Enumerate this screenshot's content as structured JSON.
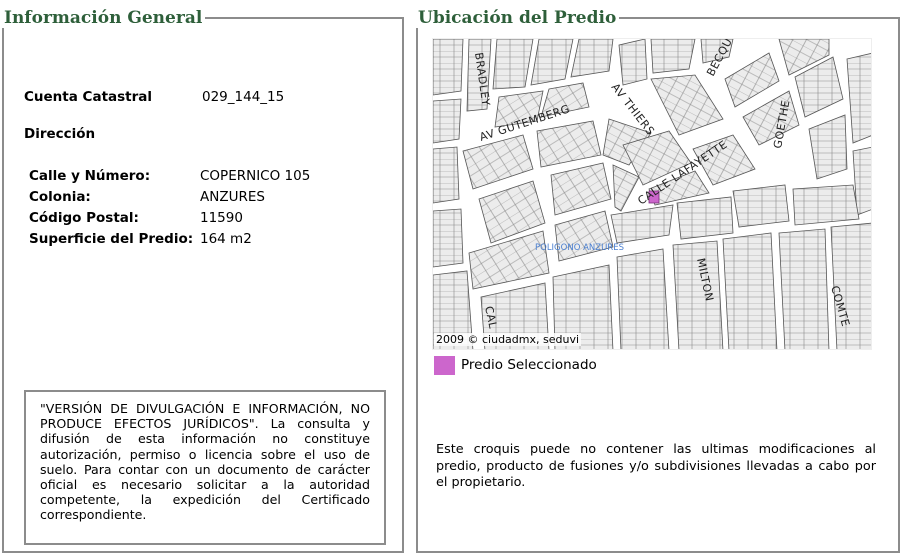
{
  "general": {
    "title": "Información General",
    "cuenta_label": "Cuenta Catastral",
    "cuenta_value": "029_144_15",
    "direccion_label": "Dirección",
    "calle_label": "Calle y Número:",
    "calle_value": "COPERNICO 105",
    "colonia_label": "Colonia:",
    "colonia_value": "ANZURES",
    "cp_label": "Código Postal:",
    "cp_value": "11590",
    "superficie_label": "Superficie del Predio:",
    "superficie_value": "164 m2",
    "disclaimer": "\"VERSIÓN DE DIVULGACIÓN E INFORMACIÓN, NO PRODUCE EFECTOS JURÍDICOS\". La consulta y difusión de esta información no constituye autorización, permiso o licencia sobre el uso de suelo. Para contar con un documento de carácter oficial es necesario solicitar a la autoridad competente, la expedición del Certificado correspondiente."
  },
  "ubicacion": {
    "title": "Ubicación del Predio",
    "streets": {
      "bradley": "BRADLEY",
      "becquer": "BECQU",
      "thiers": "AV THIERS",
      "gutemberg": "AV GUTEMBERG",
      "goethe": "GOETHE",
      "lafayette": "CALLE LAFAYETTE",
      "poligono": "POLIGONO ANZURES",
      "milton": "MILTON",
      "comte": "COMTE",
      "cal": "CAL"
    },
    "credit": "2009 © ciudadmx, seduvi",
    "legend_label": "Predio Seleccionado",
    "legend_color": "#cc66cc",
    "note": "Este croquis puede no contener las ultimas modificaciones al predio, producto de fusiones y/o subdivisiones llevadas a cabo por el propietario."
  }
}
